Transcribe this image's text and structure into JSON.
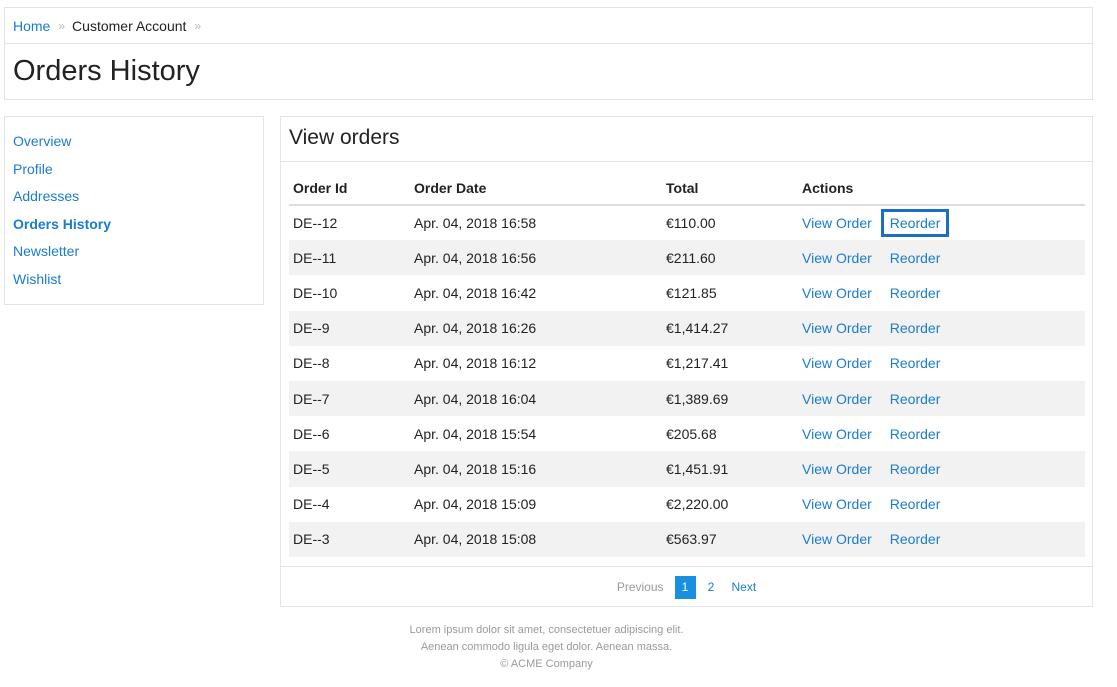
{
  "breadcrumb": {
    "home": "Home",
    "current": "Customer Account",
    "separator": "»"
  },
  "page_title": "Orders History",
  "sidebar": {
    "items": [
      {
        "label": "Overview"
      },
      {
        "label": "Profile"
      },
      {
        "label": "Addresses"
      },
      {
        "label": "Orders History",
        "active": true
      },
      {
        "label": "Newsletter"
      },
      {
        "label": "Wishlist"
      }
    ]
  },
  "orders": {
    "title": "View orders",
    "columns": {
      "id": "Order Id",
      "date": "Order Date",
      "total": "Total",
      "actions": "Actions"
    },
    "view_label": "View Order",
    "reorder_label": "Reorder",
    "rows": [
      {
        "id": "DE--12",
        "date": "Apr. 04, 2018 16:58",
        "total": "€110.00"
      },
      {
        "id": "DE--11",
        "date": "Apr. 04, 2018 16:56",
        "total": "€211.60"
      },
      {
        "id": "DE--10",
        "date": "Apr. 04, 2018 16:42",
        "total": "€121.85"
      },
      {
        "id": "DE--9",
        "date": "Apr. 04, 2018 16:26",
        "total": "€1,414.27"
      },
      {
        "id": "DE--8",
        "date": "Apr. 04, 2018 16:12",
        "total": "€1,217.41"
      },
      {
        "id": "DE--7",
        "date": "Apr. 04, 2018 16:04",
        "total": "€1,389.69"
      },
      {
        "id": "DE--6",
        "date": "Apr. 04, 2018 15:54",
        "total": "€205.68"
      },
      {
        "id": "DE--5",
        "date": "Apr. 04, 2018 15:16",
        "total": "€1,451.91"
      },
      {
        "id": "DE--4",
        "date": "Apr. 04, 2018 15:09",
        "total": "€2,220.00"
      },
      {
        "id": "DE--3",
        "date": "Apr. 04, 2018 15:08",
        "total": "€563.97"
      }
    ]
  },
  "pagination": {
    "previous": "Previous",
    "pages": [
      "1",
      "2"
    ],
    "current_page": "1",
    "next": "Next"
  },
  "footer": {
    "line1": "Lorem ipsum dolor sit amet, consectetuer adipiscing elit.",
    "line2": "Aenean commodo ligula eget dolor. Aenean massa.",
    "line3": "© ACME Company"
  },
  "colors": {
    "link": "#1a7ccf",
    "accent": "#1a8fe0",
    "focus_outline": "#1a6fc2",
    "stripe": "#f2f2f2"
  }
}
